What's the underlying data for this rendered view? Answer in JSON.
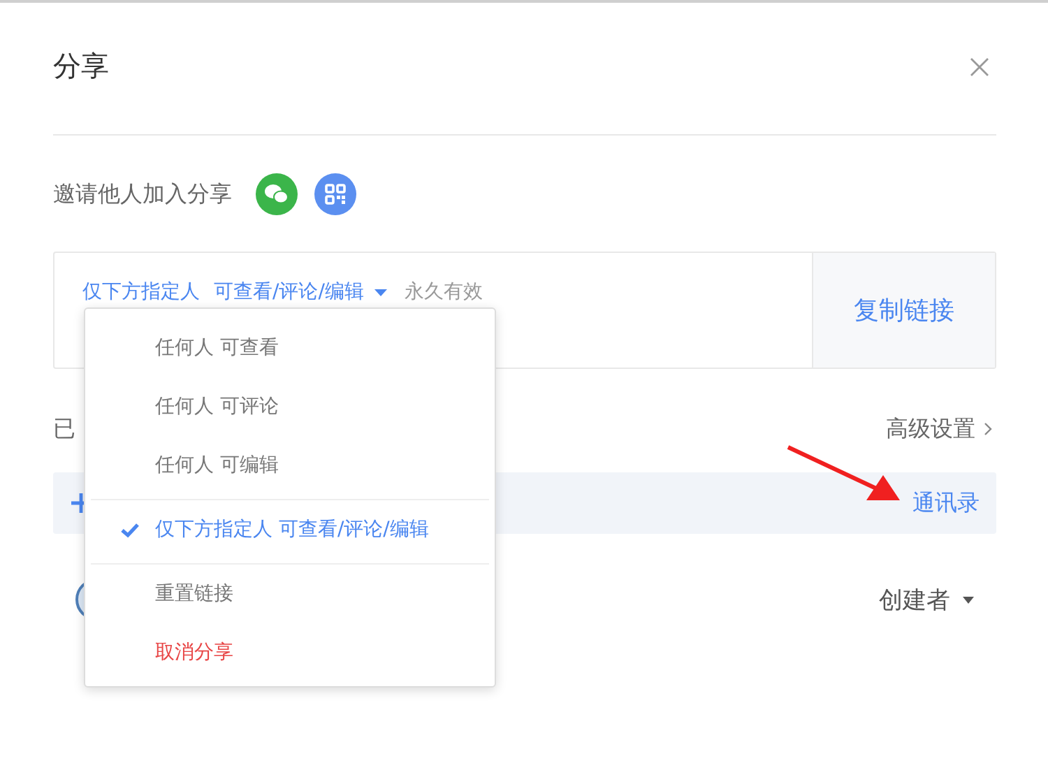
{
  "dialog": {
    "title": "分享"
  },
  "invite": {
    "label": "邀请他人加入分享"
  },
  "link": {
    "scope": "仅下方指定人",
    "permission": "可查看/评论/编辑",
    "expiry": "永久有效",
    "copy_button": "复制链接"
  },
  "menu": {
    "items": [
      {
        "label": "任何人 可查看",
        "kind": "option",
        "selected": false
      },
      {
        "label": "任何人 可评论",
        "kind": "option",
        "selected": false
      },
      {
        "label": "任何人 可编辑",
        "kind": "option",
        "selected": false
      },
      {
        "label": "仅下方指定人 可查看/评论/编辑",
        "kind": "option",
        "selected": true
      },
      {
        "label": "重置链接",
        "kind": "action",
        "selected": false
      },
      {
        "label": "取消分享",
        "kind": "danger",
        "selected": false
      }
    ]
  },
  "members": {
    "heading": "已",
    "advanced": "高级设置",
    "contacts": "通讯录",
    "role": "创建者"
  }
}
